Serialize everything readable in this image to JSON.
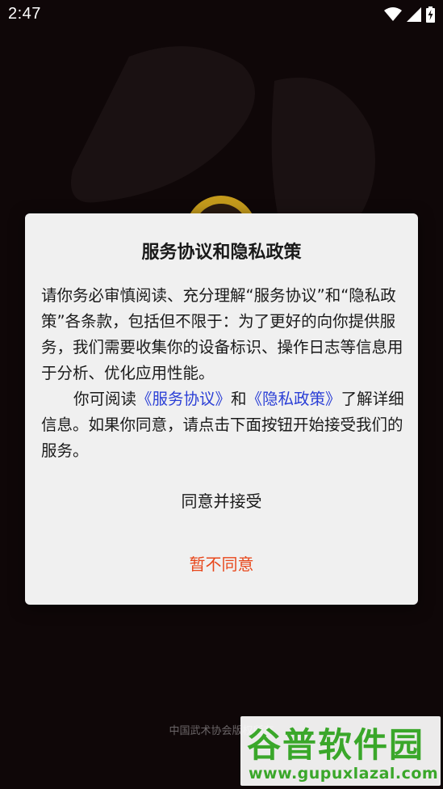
{
  "status_bar": {
    "time": "2:47",
    "icons": [
      "wifi-icon",
      "cell-signal-icon",
      "battery-charging-icon"
    ]
  },
  "footer": {
    "copyright": "中国武术协会版权所有"
  },
  "watermark": {
    "brand": "谷普软件园",
    "url": "www.gupuxlazal.com"
  },
  "dialog": {
    "title": "服务协议和隐私政策",
    "paragraph1": "请你务必审慎阅读、充分理解“服务协议”和“隐私政策”各条款，包括但不限于：为了更好的向你提供服务，我们需要收集你的设备标识、操作日志等信息用于分析、优化应用性能。",
    "paragraph2_prefix": "你可阅读",
    "service_link": "《服务协议》",
    "and_text": "和",
    "privacy_link": "《隐私政策》",
    "paragraph2_suffix": "了解详细信息。如果你同意，请点击下面按钮开始接受我们的服务。",
    "agree_label": "同意并接受",
    "decline_label": "暂不同意"
  },
  "colors": {
    "background": "#0f0708",
    "dialog_bg": "#f0f0f0",
    "link": "#2b3fd6",
    "decline": "#e8471b",
    "watermark_green": "#3aa72a"
  }
}
